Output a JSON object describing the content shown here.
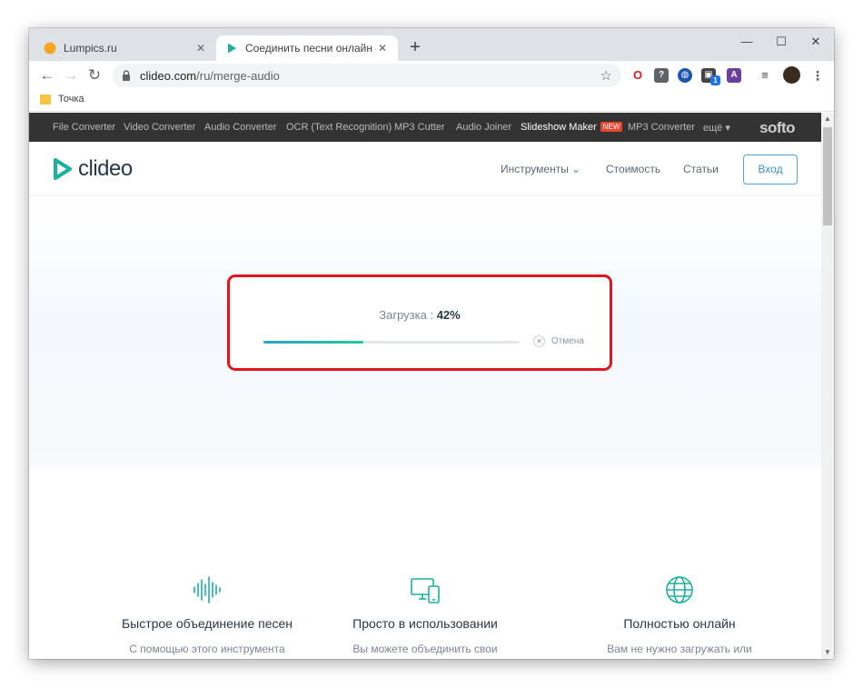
{
  "browser": {
    "tabs": [
      {
        "title": "Lumpics.ru",
        "active": false
      },
      {
        "title": "Соединить песни онлайн — Co",
        "active": true
      }
    ],
    "omnibox": {
      "host": "clideo.com",
      "path": "/ru/merge-audio"
    },
    "bookmarks": [
      {
        "label": "Точка"
      }
    ],
    "extensions": [
      "opera-icon",
      "question-icon",
      "globe-icon",
      "box-icon",
      "adblock-icon"
    ],
    "extension_badge": "1"
  },
  "softo_bar": {
    "items": [
      "File Converter",
      "Video Converter",
      "Audio Converter",
      "OCR (Text Recognition)",
      "MP3 Cutter",
      "Audio Joiner",
      "Slideshow Maker",
      "MP3 Converter",
      "ещё"
    ],
    "new_badge": "NEW",
    "logo": "softo"
  },
  "site_header": {
    "brand": "clideo",
    "menu": {
      "tools": "Инструменты",
      "pricing": "Стоимость",
      "articles": "Статьи"
    },
    "login": "Вход"
  },
  "upload": {
    "label": "Загрузка :",
    "percent_text": "42%",
    "progress": 0.39,
    "cancel": "Отмена"
  },
  "features": [
    {
      "icon": "soundwave-icon",
      "title": "Быстрое объединение песен",
      "desc": "С помощью этого инструмента"
    },
    {
      "icon": "devices-icon",
      "title": "Просто в использовании",
      "desc": "Вы можете объединить свои"
    },
    {
      "icon": "globe-icon",
      "title": "Полностью онлайн",
      "desc": "Вам не нужно загружать или"
    }
  ],
  "colors": {
    "accent": "#27c4a3",
    "brand_teal": "#1ab1a0",
    "highlight_border": "#e0161c",
    "login_blue": "#3b8fd5"
  }
}
